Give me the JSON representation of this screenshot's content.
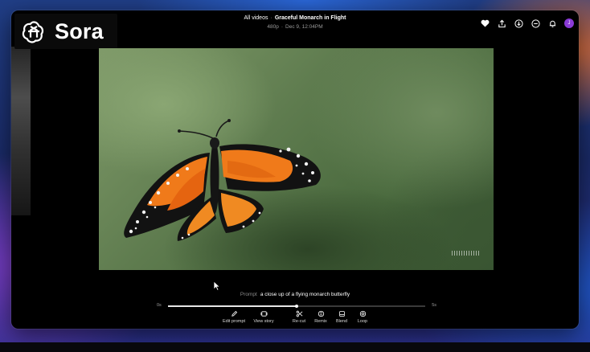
{
  "app": {
    "name": "Sora"
  },
  "header": {
    "breadcrumb_root": "All videos",
    "separator": "·",
    "video_title": "Graceful Monarch in Flight",
    "resolution": "480p",
    "date": "Dec 9, 12:04PM",
    "meta_separator": "·"
  },
  "header_icons": [
    "heart-icon",
    "share-icon",
    "download-icon",
    "more-icon",
    "notification-icon"
  ],
  "user": {
    "avatar_initial": "J",
    "avatar_color": "#8a3ad6"
  },
  "prompt": {
    "label": "Prompt",
    "text": "a close up of a flying monarch butterfly"
  },
  "timeline": {
    "start": "0s",
    "end": "5s",
    "progress": 0.5
  },
  "toolbar": {
    "items": [
      {
        "label": "Edit prompt",
        "icon": "pencil-icon"
      },
      {
        "label": "View story",
        "icon": "storyboard-icon"
      },
      {
        "label": "Re-cut",
        "icon": "scissors-icon"
      },
      {
        "label": "Remix",
        "icon": "remix-icon"
      },
      {
        "label": "Blend",
        "icon": "blend-icon"
      },
      {
        "label": "Loop",
        "icon": "loop-icon"
      }
    ]
  },
  "colors": {
    "accent": "#8a3ad6",
    "window_bg": "#000000",
    "monarch_orange": "#f07a1a"
  }
}
